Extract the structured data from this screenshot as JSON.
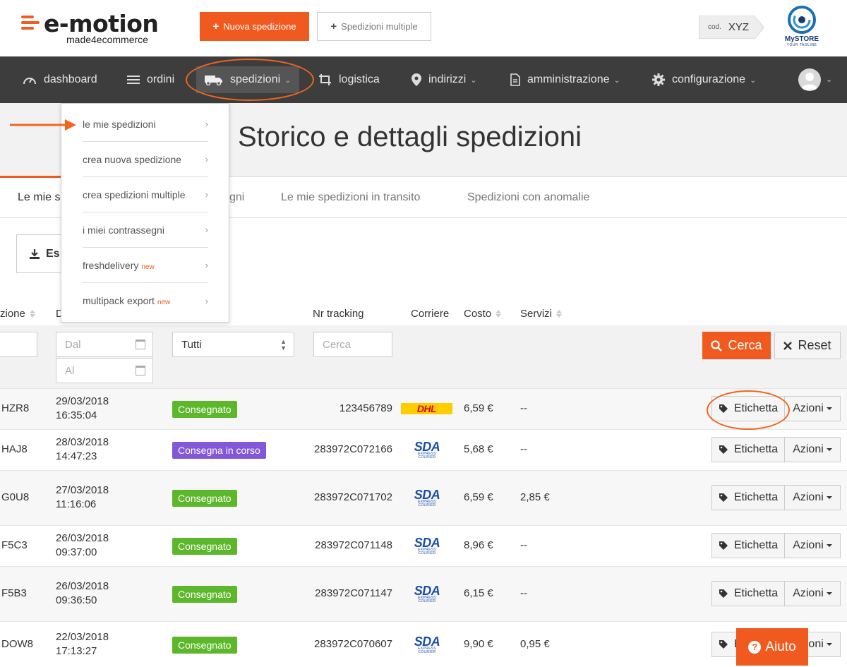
{
  "header": {
    "logo_main": "e-motion",
    "logo_sub": "made4ecommerce",
    "new_shipment_label": "Nuova spedizione",
    "multi_shipment_label": "Spedizioni multiple",
    "cod_label": "cod.",
    "cod_value": "XYZ",
    "store_name": "MySTORE",
    "store_tagline": "YOUR TAGLINE"
  },
  "nav": {
    "items": [
      {
        "label": "dashboard",
        "icon": "speedometer-icon"
      },
      {
        "label": "ordini",
        "icon": "menu-lines-icon"
      },
      {
        "label": "spedizioni",
        "icon": "truck-icon"
      },
      {
        "label": "logistica",
        "icon": "crop-icon"
      },
      {
        "label": "indirizzi",
        "icon": "map-pin-icon"
      },
      {
        "label": "amministrazione",
        "icon": "document-icon"
      },
      {
        "label": "configurazione",
        "icon": "gear-icon"
      }
    ]
  },
  "dropdown": {
    "items": [
      {
        "label": "le mie spedizioni",
        "badge": ""
      },
      {
        "label": "crea nuova spedizione",
        "badge": ""
      },
      {
        "label": "crea spedizioni multiple",
        "badge": ""
      },
      {
        "label": "i miei contrassegni",
        "badge": ""
      },
      {
        "label": "freshdelivery",
        "badge": "new"
      },
      {
        "label": "multipack export",
        "badge": "new"
      }
    ]
  },
  "page": {
    "title": "Storico e dettagli spedizioni",
    "tabs": [
      "Le mie s",
      "gni",
      "Le mie spedizioni in transito",
      "Spedizioni con anomalie"
    ],
    "export_label": "Es"
  },
  "table": {
    "headers": {
      "col1": "zione",
      "col2": "D",
      "tracking": "Nr tracking",
      "courier": "Corriere",
      "cost": "Costo",
      "services": "Servizi"
    },
    "filters": {
      "from_placeholder": "Dal",
      "to_placeholder": "Al",
      "status_value": "Tutti",
      "tracking_placeholder": "Cerca",
      "search_label": "Cerca",
      "reset_label": "Reset"
    },
    "label_button": "Etichetta",
    "actions_button": "Azioni",
    "rows": [
      {
        "code": "HZR8",
        "date": "29/03/2018",
        "time": "16:35:04",
        "status": "Consegnato",
        "status_color": "#5cb82a",
        "tracking": "123456789",
        "courier": "DHL",
        "cost": "6,59 €",
        "services": "--"
      },
      {
        "code": "HAJ8",
        "date": "28/03/2018",
        "time": "14:47:23",
        "status": "Consegna in corso",
        "status_color": "#8357d9",
        "tracking": "283972C072166",
        "courier": "SDA",
        "cost": "5,68 €",
        "services": "--"
      },
      {
        "code": "G0U8",
        "date": "27/03/2018",
        "time": "11:16:06",
        "status": "Consegnato",
        "status_color": "#5cb82a",
        "tracking": "283972C071702",
        "courier": "SDA",
        "cost": "6,59 €",
        "services": "2,85 €"
      },
      {
        "code": "F5C3",
        "date": "26/03/2018",
        "time": "09:37:00",
        "status": "Consegnato",
        "status_color": "#5cb82a",
        "tracking": "283972C071148",
        "courier": "SDA",
        "cost": "8,96 €",
        "services": "--"
      },
      {
        "code": "F5B3",
        "date": "26/03/2018",
        "time": "09:36:50",
        "status": "Consegnato",
        "status_color": "#5cb82a",
        "tracking": "283972C071147",
        "courier": "SDA",
        "cost": "6,15 €",
        "services": "--"
      },
      {
        "code": "DOW8",
        "date": "22/03/2018",
        "time": "17:13:27",
        "status": "Consegnato",
        "status_color": "#5cb82a",
        "tracking": "283972C070607",
        "courier": "SDA",
        "cost": "9,90 €",
        "services": "0,95 €"
      }
    ]
  },
  "help": {
    "label": "Aiuto"
  },
  "courier_logos": {
    "dhl": "DHL",
    "sda": "SDA",
    "sda_sub": "EXPRESS COURIER"
  },
  "colors": {
    "accent": "#f15a1f",
    "navbar": "#3d3d3d"
  }
}
